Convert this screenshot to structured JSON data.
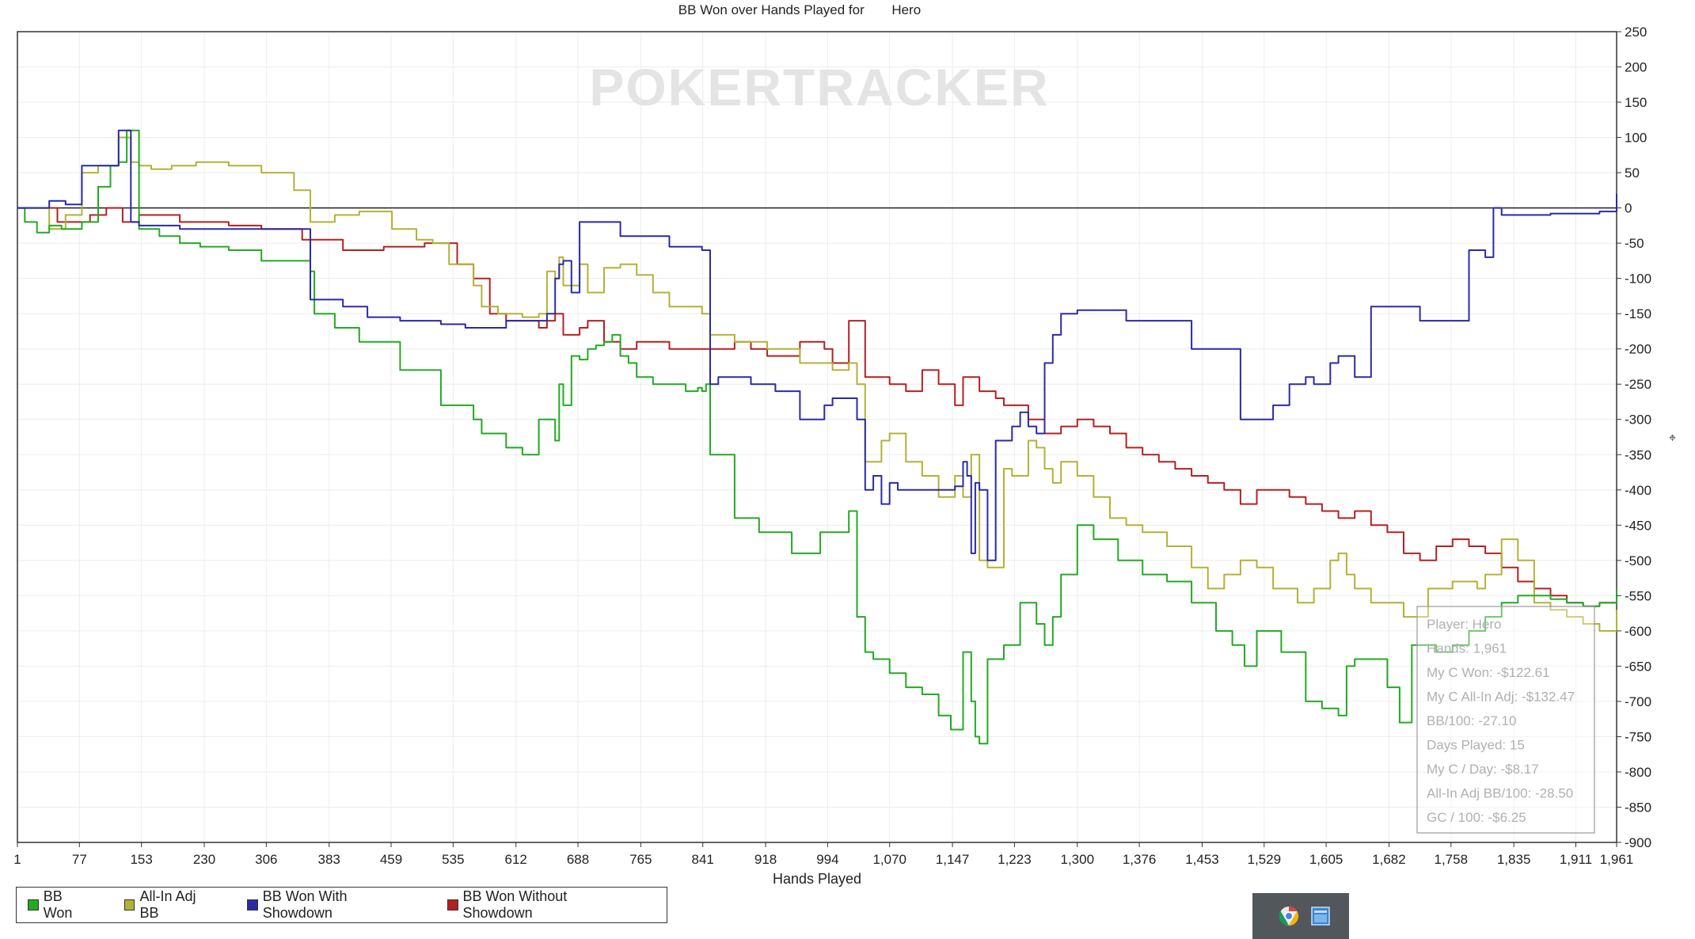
{
  "chart_data": {
    "type": "line",
    "title_prefix": "BB Won over Hands Played for",
    "title_player": "Hero",
    "xlabel": "Hands Played",
    "x_ticks": [
      "1",
      "77",
      "153",
      "230",
      "306",
      "383",
      "459",
      "535",
      "612",
      "688",
      "765",
      "841",
      "918",
      "994",
      "1,070",
      "1,147",
      "1,223",
      "1,300",
      "1,376",
      "1,453",
      "1,529",
      "1,605",
      "1,682",
      "1,758",
      "1,835",
      "1,911",
      "1,961"
    ],
    "x_range": [
      1,
      1961
    ],
    "ylim": [
      -900,
      250
    ],
    "y_ticks": [
      250,
      200,
      150,
      100,
      50,
      0,
      -50,
      -100,
      -150,
      -200,
      -250,
      -300,
      -350,
      -400,
      -450,
      -500,
      -550,
      -600,
      -650,
      -700,
      -750,
      -800,
      -850,
      -900
    ],
    "grid": true,
    "legend_position": "bottom-left",
    "watermark": "POKERTRACKER",
    "series": [
      {
        "name": "BB Won",
        "color": "#22aa22",
        "x": [
          1,
          10,
          25,
          40,
          55,
          80,
          100,
          115,
          125,
          135,
          150,
          175,
          200,
          225,
          260,
          300,
          360,
          365,
          390,
          420,
          470,
          520,
          560,
          570,
          600,
          620,
          640,
          660,
          665,
          670,
          680,
          690,
          700,
          710,
          720,
          730,
          740,
          750,
          760,
          780,
          820,
          835,
          840,
          845,
          850,
          880,
          910,
          950,
          985,
          1020,
          1030,
          1040,
          1050,
          1070,
          1090,
          1110,
          1130,
          1145,
          1160,
          1170,
          1175,
          1180,
          1190,
          1210,
          1230,
          1250,
          1260,
          1270,
          1280,
          1300,
          1320,
          1350,
          1380,
          1410,
          1440,
          1470,
          1490,
          1505,
          1520,
          1550,
          1580,
          1600,
          1620,
          1630,
          1640,
          1660,
          1680,
          1695,
          1710,
          1740,
          1760,
          1780,
          1800,
          1820,
          1840,
          1860,
          1880,
          1900,
          1920,
          1940,
          1961
        ],
        "y": [
          0,
          -20,
          -35,
          -25,
          -30,
          -20,
          30,
          60,
          65,
          110,
          -30,
          -40,
          -50,
          -55,
          -60,
          -75,
          -90,
          -150,
          -170,
          -190,
          -230,
          -280,
          -300,
          -320,
          -340,
          -350,
          -300,
          -330,
          -250,
          -280,
          -210,
          -215,
          -200,
          -195,
          -190,
          -180,
          -210,
          -220,
          -240,
          -250,
          -260,
          -255,
          -260,
          -250,
          -350,
          -440,
          -460,
          -490,
          -460,
          -430,
          -580,
          -630,
          -640,
          -660,
          -680,
          -690,
          -720,
          -740,
          -630,
          -700,
          -750,
          -760,
          -640,
          -620,
          -560,
          -590,
          -620,
          -580,
          -520,
          -450,
          -470,
          -500,
          -520,
          -530,
          -560,
          -600,
          -620,
          -650,
          -600,
          -630,
          -700,
          -710,
          -720,
          -650,
          -640,
          -640,
          -680,
          -730,
          -620,
          -630,
          -620,
          -600,
          -580,
          -560,
          -550,
          -550,
          -555,
          -560,
          -565,
          -560,
          -540
        ]
      },
      {
        "name": "All-In Adj BB",
        "color": "#b2b234",
        "x": [
          1,
          40,
          60,
          80,
          100,
          125,
          140,
          150,
          165,
          190,
          220,
          260,
          300,
          340,
          360,
          390,
          420,
          460,
          490,
          510,
          530,
          560,
          570,
          590,
          620,
          640,
          650,
          660,
          665,
          670,
          690,
          700,
          720,
          740,
          760,
          780,
          800,
          840,
          850,
          880,
          920,
          960,
          995,
          1000,
          1020,
          1030,
          1040,
          1060,
          1070,
          1090,
          1110,
          1130,
          1150,
          1160,
          1170,
          1180,
          1190,
          1210,
          1220,
          1240,
          1250,
          1260,
          1270,
          1280,
          1300,
          1320,
          1340,
          1360,
          1380,
          1410,
          1440,
          1460,
          1480,
          1500,
          1520,
          1540,
          1570,
          1590,
          1610,
          1620,
          1630,
          1640,
          1660,
          1700,
          1730,
          1760,
          1790,
          1800,
          1820,
          1840,
          1860,
          1880,
          1900,
          1920,
          1940,
          1961
        ],
        "y": [
          0,
          -30,
          -10,
          50,
          60,
          100,
          65,
          60,
          55,
          60,
          65,
          60,
          50,
          25,
          -20,
          -10,
          -5,
          -30,
          -45,
          -50,
          -80,
          -110,
          -140,
          -150,
          -155,
          -150,
          -90,
          -100,
          -70,
          -110,
          -80,
          -120,
          -85,
          -80,
          -95,
          -120,
          -140,
          -150,
          -180,
          -190,
          -200,
          -220,
          -220,
          -230,
          -220,
          -250,
          -360,
          -330,
          -320,
          -360,
          -380,
          -410,
          -380,
          -410,
          -350,
          -500,
          -510,
          -370,
          -380,
          -330,
          -340,
          -370,
          -390,
          -360,
          -380,
          -410,
          -440,
          -450,
          -460,
          -480,
          -510,
          -540,
          -520,
          -500,
          -510,
          -540,
          -560,
          -540,
          -500,
          -490,
          -520,
          -540,
          -560,
          -580,
          -540,
          -530,
          -540,
          -520,
          -470,
          -500,
          -560,
          -570,
          -580,
          -590,
          -600,
          -570
        ]
      },
      {
        "name": "BB Won With Showdown",
        "color": "#2a2aa8",
        "x": [
          1,
          40,
          60,
          80,
          100,
          125,
          140,
          150,
          200,
          260,
          300,
          360,
          365,
          400,
          430,
          470,
          520,
          550,
          600,
          620,
          640,
          650,
          660,
          665,
          670,
          680,
          690,
          700,
          710,
          740,
          760,
          800,
          840,
          850,
          860,
          900,
          930,
          960,
          990,
          1000,
          1030,
          1040,
          1050,
          1060,
          1070,
          1080,
          1100,
          1130,
          1150,
          1160,
          1165,
          1170,
          1175,
          1180,
          1190,
          1200,
          1220,
          1230,
          1240,
          1250,
          1260,
          1270,
          1280,
          1300,
          1330,
          1360,
          1400,
          1440,
          1480,
          1500,
          1520,
          1540,
          1560,
          1580,
          1590,
          1610,
          1620,
          1640,
          1660,
          1700,
          1720,
          1740,
          1760,
          1780,
          1790,
          1800,
          1810,
          1820,
          1830,
          1840,
          1860,
          1880,
          1900,
          1920,
          1940,
          1961
        ],
        "y": [
          0,
          10,
          5,
          60,
          60,
          110,
          -20,
          -25,
          -30,
          -30,
          -30,
          -130,
          -130,
          -140,
          -155,
          -160,
          -165,
          -170,
          -160,
          -160,
          -160,
          -150,
          -100,
          -80,
          -75,
          -120,
          -20,
          -20,
          -20,
          -40,
          -40,
          -55,
          -60,
          -250,
          -240,
          -250,
          -260,
          -300,
          -280,
          -270,
          -300,
          -400,
          -380,
          -420,
          -390,
          -400,
          -400,
          -400,
          -395,
          -360,
          -380,
          -490,
          -390,
          -400,
          -500,
          -330,
          -310,
          -290,
          -310,
          -320,
          -220,
          -180,
          -150,
          -145,
          -145,
          -160,
          -160,
          -200,
          -200,
          -300,
          -300,
          -280,
          -250,
          -240,
          -250,
          -220,
          -210,
          -240,
          -140,
          -140,
          -160,
          -160,
          -160,
          -60,
          -60,
          -70,
          0,
          -10,
          -10,
          -10,
          -10,
          -8,
          -8,
          -8,
          -5,
          20
        ]
      },
      {
        "name": "BB Won Without Showdown",
        "color": "#b52020",
        "x": [
          1,
          50,
          90,
          110,
          130,
          150,
          200,
          260,
          300,
          350,
          400,
          450,
          500,
          540,
          560,
          580,
          600,
          640,
          650,
          660,
          670,
          680,
          690,
          700,
          720,
          740,
          760,
          800,
          840,
          860,
          880,
          900,
          920,
          960,
          990,
          1000,
          1020,
          1040,
          1060,
          1070,
          1090,
          1110,
          1130,
          1150,
          1160,
          1180,
          1200,
          1210,
          1240,
          1260,
          1280,
          1300,
          1320,
          1340,
          1360,
          1380,
          1400,
          1420,
          1440,
          1460,
          1480,
          1500,
          1520,
          1540,
          1560,
          1580,
          1600,
          1620,
          1640,
          1660,
          1680,
          1700,
          1720,
          1740,
          1760,
          1780,
          1800,
          1820,
          1840,
          1860,
          1880,
          1900,
          1920,
          1940,
          1961
        ],
        "y": [
          0,
          -20,
          -10,
          0,
          -20,
          -10,
          -20,
          -25,
          -30,
          -45,
          -60,
          -55,
          -50,
          -80,
          -100,
          -150,
          -160,
          -170,
          -160,
          -150,
          -180,
          -180,
          -170,
          -160,
          -190,
          -200,
          -190,
          -200,
          -200,
          -200,
          -190,
          -200,
          -210,
          -190,
          -200,
          -220,
          -160,
          -240,
          -240,
          -250,
          -260,
          -230,
          -250,
          -280,
          -240,
          -260,
          -270,
          -280,
          -300,
          -320,
          -310,
          -300,
          -310,
          -320,
          -340,
          -350,
          -360,
          -370,
          -380,
          -390,
          -400,
          -420,
          -400,
          -400,
          -410,
          -420,
          -430,
          -440,
          -430,
          -450,
          -460,
          -490,
          -500,
          -480,
          -470,
          -480,
          -490,
          -510,
          -530,
          -540,
          -550,
          -560,
          -565,
          -560,
          -545
        ]
      }
    ],
    "tooltip": [
      "Player: Hero",
      "Hands: 1,961",
      "My C Won: -$122.61",
      "My C All-In Adj: -$132.47",
      "BB/100: -27.10",
      "Days Played: 15",
      "My C / Day: -$8.17",
      "All-In Adj BB/100: -28.50",
      "GC / 100: -$6.25"
    ]
  },
  "legend": [
    {
      "label": "BB Won",
      "color": "#22aa22"
    },
    {
      "label": "All-In Adj BB",
      "color": "#b2b234"
    },
    {
      "label": "BB Won With Showdown",
      "color": "#2a2aa8"
    },
    {
      "label": "BB Won Without Showdown",
      "color": "#b52020"
    }
  ],
  "taskbar": {
    "icons": [
      "chrome-icon",
      "window-icon"
    ]
  }
}
